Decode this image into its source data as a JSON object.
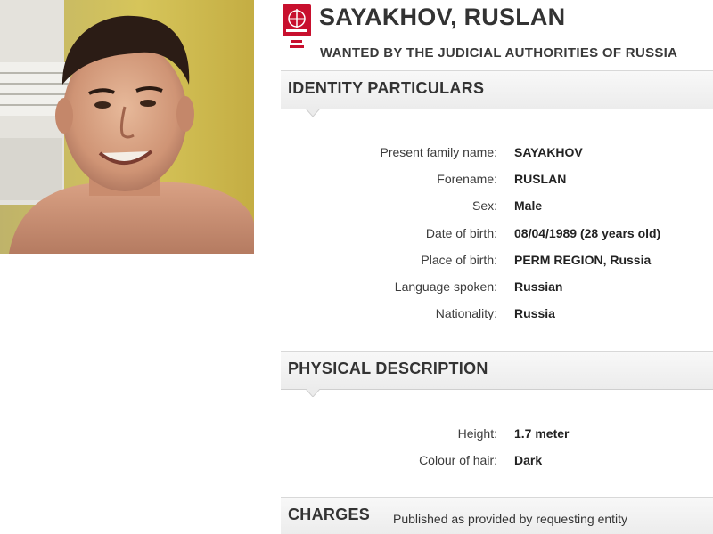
{
  "header": {
    "name": "SAYAKHOV, RUSLAN",
    "subtitle": "WANTED BY THE JUDICIAL AUTHORITIES OF RUSSIA"
  },
  "logo": {
    "icon": "interpol-logo",
    "color": "#c8102e"
  },
  "photo": {
    "icon": "person-photo"
  },
  "identity": {
    "title": "IDENTITY PARTICULARS",
    "fields": [
      {
        "label": "Present family name:",
        "value": "SAYAKHOV"
      },
      {
        "label": "Forename:",
        "value": "RUSLAN"
      },
      {
        "label": "Sex:",
        "value": "Male"
      },
      {
        "label": "Date of birth:",
        "value": "08/04/1989 (28 years old)"
      },
      {
        "label": "Place of birth:",
        "value": "PERM REGION, Russia"
      },
      {
        "label": "Language spoken:",
        "value": "Russian"
      },
      {
        "label": "Nationality:",
        "value": "Russia"
      }
    ]
  },
  "physical": {
    "title": "PHYSICAL DESCRIPTION",
    "fields": [
      {
        "label": "Height:",
        "value": "1.7 meter"
      },
      {
        "label": "Colour of hair:",
        "value": "Dark"
      }
    ]
  },
  "charges": {
    "title": "CHARGES",
    "note": "Published as provided by requesting entity"
  },
  "colors": {
    "section_bg": "#f0f0f0",
    "text": "#333333",
    "brand_red": "#c8102e"
  }
}
